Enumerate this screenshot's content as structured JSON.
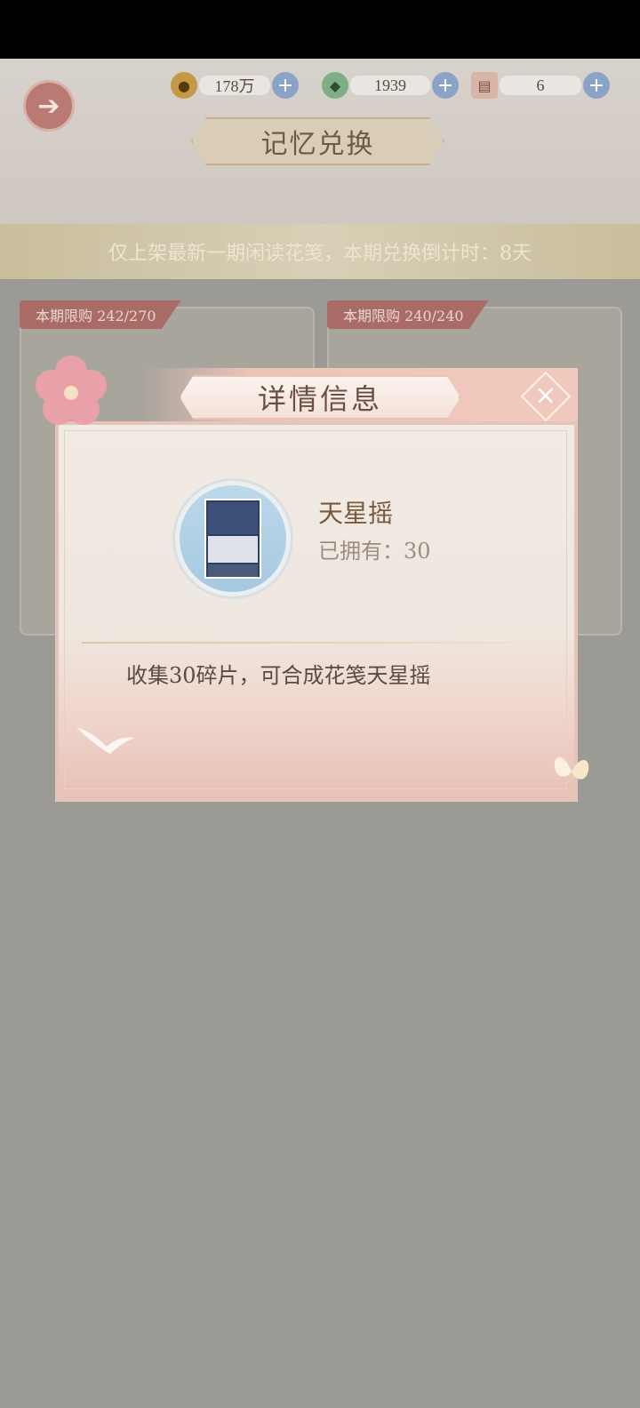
{
  "header": {
    "title": "记忆兑换",
    "currencies": [
      {
        "icon": "paw-coin-icon",
        "value": "178万"
      },
      {
        "icon": "jade-icon",
        "value": "1939"
      },
      {
        "icon": "scroll-ticket-icon",
        "value": "6"
      }
    ]
  },
  "notice": "仅上架最新一期闲读花笺，本期兑换倒计时：8天",
  "cards": [
    {
      "tag": "本期限购 242/270"
    },
    {
      "tag": "本期限购 240/240"
    }
  ],
  "modal": {
    "title": "详情信息",
    "item_name": "天星摇",
    "owned": "已拥有：30",
    "description": "收集30碎片，可合成花笺天星摇"
  },
  "colors": {
    "accent": "#a96b66",
    "modal_bg": "#f0ebe3",
    "overlay": "#9b9a94"
  }
}
